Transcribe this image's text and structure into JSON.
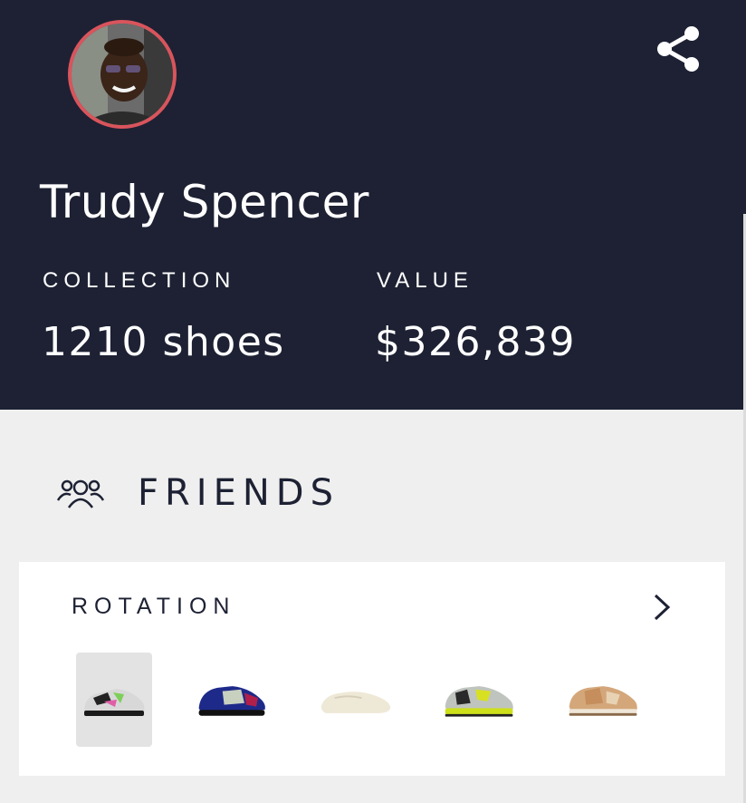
{
  "profile": {
    "name": "Trudy Spencer",
    "avatar": "profile-photo",
    "avatar_ring_color": "#d9545c"
  },
  "stats": {
    "collection_label": "COLLECTION",
    "collection_value": "1210 shoes",
    "value_label": "VALUE",
    "value_value": "$326,839"
  },
  "actions": {
    "share_icon": "share-icon"
  },
  "friends": {
    "label": "FRIENDS",
    "icon": "people-group-icon"
  },
  "rotation": {
    "title": "ROTATION",
    "chevron_icon": "chevron-right-icon",
    "shoes": [
      {
        "name": "shoe-thumbnail-1",
        "selected": true
      },
      {
        "name": "shoe-thumbnail-2",
        "selected": false
      },
      {
        "name": "shoe-thumbnail-3",
        "selected": false
      },
      {
        "name": "shoe-thumbnail-4",
        "selected": false
      },
      {
        "name": "shoe-thumbnail-5",
        "selected": false
      }
    ]
  },
  "colors": {
    "header_bg": "#1d2133",
    "page_bg": "#efefef",
    "card_bg": "#ffffff",
    "text_dark": "#1d2133"
  }
}
